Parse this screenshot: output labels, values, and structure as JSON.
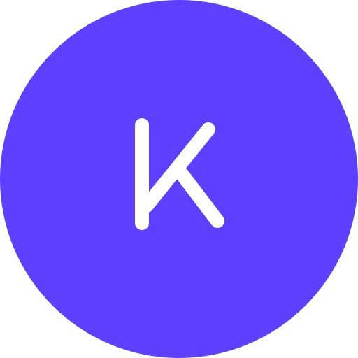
{
  "avatar": {
    "initial": "K",
    "background_color": "#5E3EFF",
    "foreground_color": "#FFFFFF"
  }
}
